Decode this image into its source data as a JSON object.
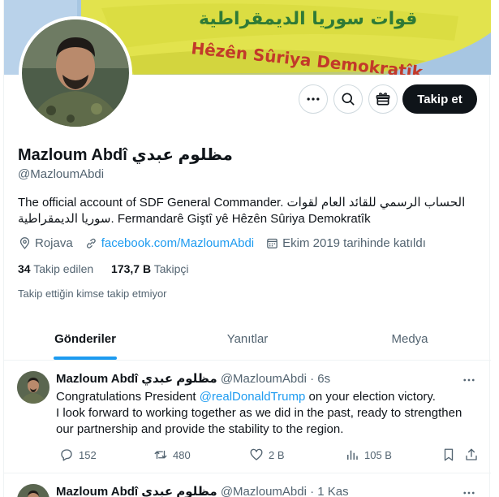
{
  "profile": {
    "display_name": "Mazloum Abdî مظلوم عبدي",
    "handle": "@MazloumAbdi",
    "bio_line1": "The official account of SDF General Commander. الحساب الرسمي للقائد العام لقوات",
    "bio_line2": "سوريا الديمقراطية. Fermandarê Giştî yê Hêzên Sûriya Demokratîk",
    "location": "Rojava",
    "website": "facebook.com/MazloumAbdi",
    "joined": "Ekim 2019 tarihinde katıldı",
    "following_count": "34",
    "following_label": "Takip edilen",
    "followers_count": "173,7 B",
    "followers_label": "Takipçi",
    "not_followed_text": "Takip ettiğin kimse takip etmiyor"
  },
  "actions": {
    "follow_label": "Takip et",
    "more_icon": "more-icon",
    "search_icon": "search-icon",
    "subscribe_icon": "gift-icon"
  },
  "tabs": [
    {
      "label": "Gönderiler",
      "active": true
    },
    {
      "label": "Yanıtlar",
      "active": false
    },
    {
      "label": "Medya",
      "active": false
    }
  ],
  "tweets": [
    {
      "name": "Mazloum Abdî مظلوم عبدي",
      "handle": "@MazloumAbdi",
      "time": "· 6s",
      "text_pre": "Congratulations President ",
      "mention": "@realDonaldTrump",
      "text_post": " on your election victory.",
      "text_line2": "I look forward to working together as we did in the past, ready to strengthen our partnership and provide the stability to the region.",
      "replies": "152",
      "reposts": "480",
      "likes": "2 B",
      "views": "105 B"
    },
    {
      "name": "Mazloum Abdî مظلوم عبدي",
      "handle": "@MazloumAbdi",
      "time": "· 1 Kas"
    }
  ],
  "colors": {
    "accent": "#1d9bf0",
    "text": "#0f1419",
    "secondary": "#536471",
    "banner_flag": "#e5e64a"
  },
  "banner": {
    "flag_arabic": "قوات سوريا الديمقراطية",
    "flag_kurdish": "Hêzên Sûriya Demokratîk"
  }
}
